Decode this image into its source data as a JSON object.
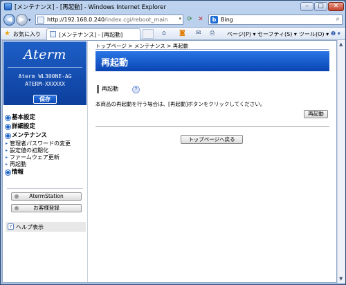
{
  "window": {
    "title": "[メンテナンス] - [再起動] - Windows Internet Explorer",
    "min_label": "–",
    "max_label": "□",
    "close_label": "✕"
  },
  "address": {
    "url_host": "http://192.168.0.240",
    "url_path": "/index.cgi/reboot_main",
    "refresh_label": "⟳",
    "stop_label": "✕"
  },
  "search": {
    "placeholder": "Bing",
    "logo": "b"
  },
  "commandbar": {
    "favorites_label": "お気に入り",
    "tab_title": "[メンテナンス] - [再起動]",
    "page_label": "ページ(P) ▾",
    "safety_label": "セーフティ(S) ▾",
    "tools_label": "ツール(O) ▾",
    "help_label": "❷ ▾",
    "icons": [
      "home-icon",
      "feeds-icon",
      "mail-icon",
      "print-icon"
    ]
  },
  "sidebar": {
    "logo_text": "Aterm",
    "model_line1": "Aterm WL300NE-AG",
    "model_line2": "ATERM-XXXXXX",
    "save_label": "保存",
    "menu": {
      "basic": "基本設定",
      "detail": "詳細設定",
      "maintenance": "メンテナンス",
      "maintenance_items": [
        "管理者パスワードの変更",
        "設定値の初期化",
        "ファームウェア更新",
        "再起動"
      ],
      "info": "情報"
    },
    "aterm_station_label": "AtermStation",
    "customer_reg_label": "お客様登録",
    "help_label": "ヘルプ表示"
  },
  "main": {
    "breadcrumb": "トップページ > メンテナンス > 再起動",
    "page_title": "再起動",
    "section_title": "再起動",
    "description": "本商品の再起動を行う場合は、[再起動]ボタンをクリックしてください。",
    "reboot_button": "再起動",
    "back_button": "トップページへ戻る"
  },
  "colors": {
    "header_blue": "#0a44b3",
    "brand_blue": "#1d5fc7"
  }
}
